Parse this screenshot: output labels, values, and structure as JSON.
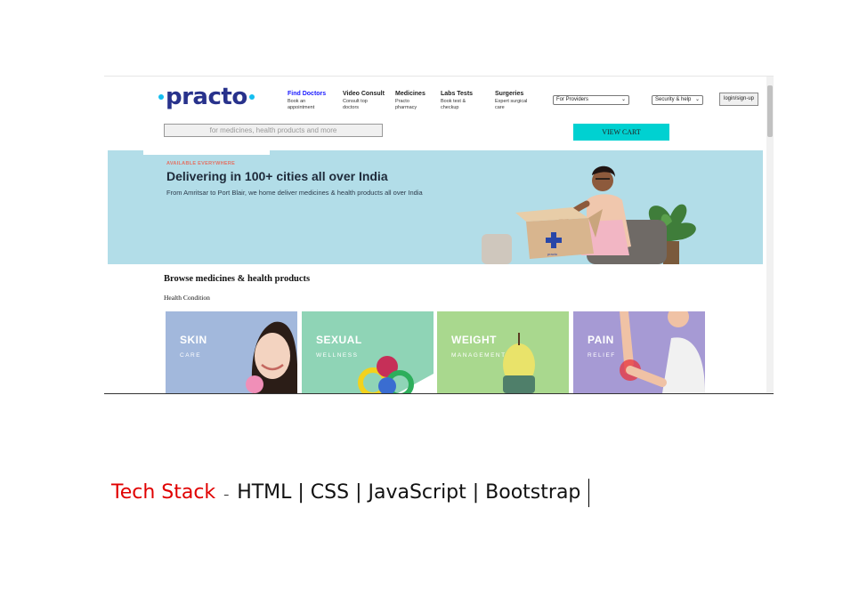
{
  "header": {
    "logo_text": "practo",
    "nav": [
      {
        "title": "Find Doctors",
        "sub": "Book an appointment"
      },
      {
        "title": "Video Consult",
        "sub": "Consult top doctors"
      },
      {
        "title": "Medicines",
        "sub": "Practo pharmacy"
      },
      {
        "title": "Labs Tests",
        "sub": "Book test & checkup"
      },
      {
        "title": "Surgeries",
        "sub": "Expert surgical care"
      }
    ],
    "providers_select": "For Providers",
    "security_select": "Security & help",
    "login_label": "login/sign-up"
  },
  "search": {
    "placeholder": "for medicines, health products and more"
  },
  "cart": {
    "label": "VIEW CART"
  },
  "banner": {
    "kicker": "AVAILABLE EVERYWHERE",
    "title": "Delivering in 100+ cities all over India",
    "subtitle": "From Amritsar to Port Blair, we home deliver medicines & health products all over India",
    "box_label": "practo"
  },
  "browse": {
    "title": "Browse medicines & health products",
    "subheading": "Health Condition",
    "cards": [
      {
        "title": "SKIN",
        "sub": "CARE",
        "color": "#a2b8dc"
      },
      {
        "title": "SEXUAL",
        "sub": "WELLNESS",
        "color": "#8fd4b6"
      },
      {
        "title": "WEIGHT",
        "sub": "MANAGEMENT",
        "color": "#a9d88e"
      },
      {
        "title": "PAIN",
        "sub": "RELIEF",
        "color": "#a69ad4"
      }
    ]
  },
  "caption": {
    "label": "Tech Stack",
    "dash": "–",
    "text": "HTML | CSS | JavaScript | Bootstrap"
  },
  "colors": {
    "brand_navy": "#28328c",
    "brand_cyan": "#14bef0",
    "cart": "#00d1d1",
    "caption_label": "#e00000"
  }
}
